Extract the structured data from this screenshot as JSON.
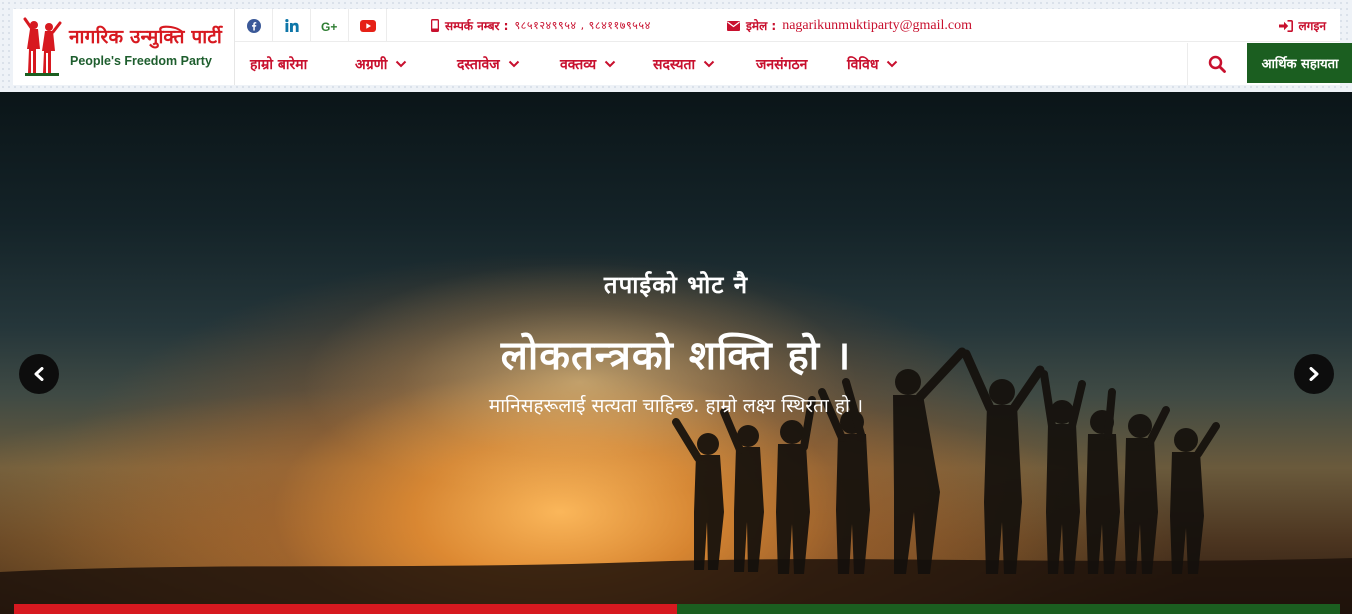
{
  "brand": {
    "name_np": "नागरिक उन्मुक्ति पार्टी",
    "name_en": "People's Freedom Party",
    "red": "#d71920",
    "green": "#1b5e20"
  },
  "topbar": {
    "social": [
      {
        "icon": "facebook-icon"
      },
      {
        "icon": "linkedin-icon"
      },
      {
        "icon": "google-plus-icon"
      },
      {
        "icon": "youtube-icon"
      }
    ],
    "phone_label": "सम्पर्क नम्बर :",
    "phone_value": "९८५१२४९९५४ , ९८४११७९५५४",
    "email_label": "इमेल :",
    "email_value": "nagarikunmuktiparty@gmail.com",
    "login_label": "लगइन"
  },
  "nav": {
    "items": [
      {
        "label": "हाम्रो बारेमा",
        "dropdown": false
      },
      {
        "label": "अग्रणी",
        "dropdown": true
      },
      {
        "label": "दस्तावेज",
        "dropdown": true
      },
      {
        "label": "वक्तव्य",
        "dropdown": true
      },
      {
        "label": "सदस्यता",
        "dropdown": true
      },
      {
        "label": "जनसंगठन",
        "dropdown": false
      },
      {
        "label": "विविध",
        "dropdown": true
      }
    ],
    "donate_label": "आर्थिक सहायता"
  },
  "hero": {
    "line1": "तपाईको भोट नै",
    "line2": "लोकतन्त्रको शक्ति हो ।",
    "line3": "मानिसहरूलाई सत्यता चाहिन्छ. हाम्रो लक्ष्य स्थिरता हो ।"
  }
}
